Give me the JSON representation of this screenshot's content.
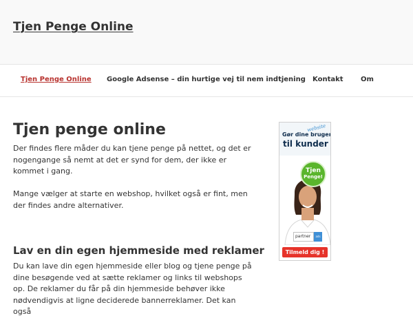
{
  "site": {
    "title": "Tjen Penge Online"
  },
  "nav": {
    "items": [
      {
        "label": "Tjen Penge Online",
        "active": true
      },
      {
        "label": "Google Adsense – din hurtige vej til nem indtjening",
        "active": false
      },
      {
        "label": "Kontakt",
        "active": false
      },
      {
        "label": "Om",
        "active": false
      }
    ],
    "active_color": "#b8332f"
  },
  "main": {
    "title": "Tjen penge online",
    "paragraphs": [
      "Der findes flere måder du kan tjene penge på nettet, og det er nogengange så nemt at det er synd for dem, der ikke er kommet i gang.",
      "Mange vælger at starte en webshop, hvilket også er fint, men der findes andre alternativer."
    ],
    "section": {
      "heading": "Lav en din egen hjemmeside med reklamer",
      "text": "Du kan lave din egen hjemmeside eller blog og tjene penge på dine besøgende  ved at sætte reklamer og links til webshops op. De reklamer du får på din hjemmeside behøver ikke nødvendigvis at ligne deciderede bannerreklamer. Det kan også"
    }
  },
  "ad": {
    "tag": "website",
    "headline_1": "Gør dine brugere",
    "headline_2": "til kunder",
    "badge_1": "Tjen",
    "badge_2": "Penge!",
    "brand": "partner",
    "brand_box": "ads",
    "cta": "Tilmeld dig !",
    "colors": {
      "cta": "#e6332a",
      "badge": "#5ab52c",
      "brand": "#3f8fd6"
    }
  }
}
